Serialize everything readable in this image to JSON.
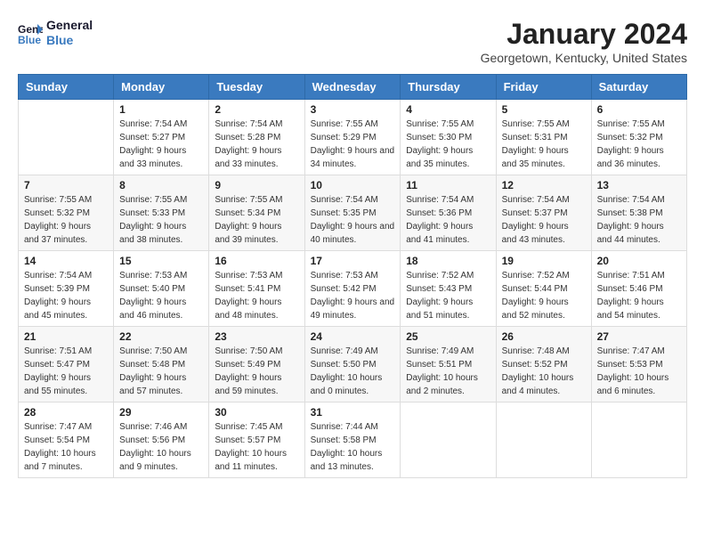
{
  "header": {
    "logo_line1": "General",
    "logo_line2": "Blue",
    "month_title": "January 2024",
    "location": "Georgetown, Kentucky, United States"
  },
  "weekdays": [
    "Sunday",
    "Monday",
    "Tuesday",
    "Wednesday",
    "Thursday",
    "Friday",
    "Saturday"
  ],
  "weeks": [
    [
      {
        "day": "",
        "sunrise": "",
        "sunset": "",
        "daylight": ""
      },
      {
        "day": "1",
        "sunrise": "Sunrise: 7:54 AM",
        "sunset": "Sunset: 5:27 PM",
        "daylight": "Daylight: 9 hours and 33 minutes."
      },
      {
        "day": "2",
        "sunrise": "Sunrise: 7:54 AM",
        "sunset": "Sunset: 5:28 PM",
        "daylight": "Daylight: 9 hours and 33 minutes."
      },
      {
        "day": "3",
        "sunrise": "Sunrise: 7:55 AM",
        "sunset": "Sunset: 5:29 PM",
        "daylight": "Daylight: 9 hours and 34 minutes."
      },
      {
        "day": "4",
        "sunrise": "Sunrise: 7:55 AM",
        "sunset": "Sunset: 5:30 PM",
        "daylight": "Daylight: 9 hours and 35 minutes."
      },
      {
        "day": "5",
        "sunrise": "Sunrise: 7:55 AM",
        "sunset": "Sunset: 5:31 PM",
        "daylight": "Daylight: 9 hours and 35 minutes."
      },
      {
        "day": "6",
        "sunrise": "Sunrise: 7:55 AM",
        "sunset": "Sunset: 5:32 PM",
        "daylight": "Daylight: 9 hours and 36 minutes."
      }
    ],
    [
      {
        "day": "7",
        "sunrise": "Sunrise: 7:55 AM",
        "sunset": "Sunset: 5:32 PM",
        "daylight": "Daylight: 9 hours and 37 minutes."
      },
      {
        "day": "8",
        "sunrise": "Sunrise: 7:55 AM",
        "sunset": "Sunset: 5:33 PM",
        "daylight": "Daylight: 9 hours and 38 minutes."
      },
      {
        "day": "9",
        "sunrise": "Sunrise: 7:55 AM",
        "sunset": "Sunset: 5:34 PM",
        "daylight": "Daylight: 9 hours and 39 minutes."
      },
      {
        "day": "10",
        "sunrise": "Sunrise: 7:54 AM",
        "sunset": "Sunset: 5:35 PM",
        "daylight": "Daylight: 9 hours and 40 minutes."
      },
      {
        "day": "11",
        "sunrise": "Sunrise: 7:54 AM",
        "sunset": "Sunset: 5:36 PM",
        "daylight": "Daylight: 9 hours and 41 minutes."
      },
      {
        "day": "12",
        "sunrise": "Sunrise: 7:54 AM",
        "sunset": "Sunset: 5:37 PM",
        "daylight": "Daylight: 9 hours and 43 minutes."
      },
      {
        "day": "13",
        "sunrise": "Sunrise: 7:54 AM",
        "sunset": "Sunset: 5:38 PM",
        "daylight": "Daylight: 9 hours and 44 minutes."
      }
    ],
    [
      {
        "day": "14",
        "sunrise": "Sunrise: 7:54 AM",
        "sunset": "Sunset: 5:39 PM",
        "daylight": "Daylight: 9 hours and 45 minutes."
      },
      {
        "day": "15",
        "sunrise": "Sunrise: 7:53 AM",
        "sunset": "Sunset: 5:40 PM",
        "daylight": "Daylight: 9 hours and 46 minutes."
      },
      {
        "day": "16",
        "sunrise": "Sunrise: 7:53 AM",
        "sunset": "Sunset: 5:41 PM",
        "daylight": "Daylight: 9 hours and 48 minutes."
      },
      {
        "day": "17",
        "sunrise": "Sunrise: 7:53 AM",
        "sunset": "Sunset: 5:42 PM",
        "daylight": "Daylight: 9 hours and 49 minutes."
      },
      {
        "day": "18",
        "sunrise": "Sunrise: 7:52 AM",
        "sunset": "Sunset: 5:43 PM",
        "daylight": "Daylight: 9 hours and 51 minutes."
      },
      {
        "day": "19",
        "sunrise": "Sunrise: 7:52 AM",
        "sunset": "Sunset: 5:44 PM",
        "daylight": "Daylight: 9 hours and 52 minutes."
      },
      {
        "day": "20",
        "sunrise": "Sunrise: 7:51 AM",
        "sunset": "Sunset: 5:46 PM",
        "daylight": "Daylight: 9 hours and 54 minutes."
      }
    ],
    [
      {
        "day": "21",
        "sunrise": "Sunrise: 7:51 AM",
        "sunset": "Sunset: 5:47 PM",
        "daylight": "Daylight: 9 hours and 55 minutes."
      },
      {
        "day": "22",
        "sunrise": "Sunrise: 7:50 AM",
        "sunset": "Sunset: 5:48 PM",
        "daylight": "Daylight: 9 hours and 57 minutes."
      },
      {
        "day": "23",
        "sunrise": "Sunrise: 7:50 AM",
        "sunset": "Sunset: 5:49 PM",
        "daylight": "Daylight: 9 hours and 59 minutes."
      },
      {
        "day": "24",
        "sunrise": "Sunrise: 7:49 AM",
        "sunset": "Sunset: 5:50 PM",
        "daylight": "Daylight: 10 hours and 0 minutes."
      },
      {
        "day": "25",
        "sunrise": "Sunrise: 7:49 AM",
        "sunset": "Sunset: 5:51 PM",
        "daylight": "Daylight: 10 hours and 2 minutes."
      },
      {
        "day": "26",
        "sunrise": "Sunrise: 7:48 AM",
        "sunset": "Sunset: 5:52 PM",
        "daylight": "Daylight: 10 hours and 4 minutes."
      },
      {
        "day": "27",
        "sunrise": "Sunrise: 7:47 AM",
        "sunset": "Sunset: 5:53 PM",
        "daylight": "Daylight: 10 hours and 6 minutes."
      }
    ],
    [
      {
        "day": "28",
        "sunrise": "Sunrise: 7:47 AM",
        "sunset": "Sunset: 5:54 PM",
        "daylight": "Daylight: 10 hours and 7 minutes."
      },
      {
        "day": "29",
        "sunrise": "Sunrise: 7:46 AM",
        "sunset": "Sunset: 5:56 PM",
        "daylight": "Daylight: 10 hours and 9 minutes."
      },
      {
        "day": "30",
        "sunrise": "Sunrise: 7:45 AM",
        "sunset": "Sunset: 5:57 PM",
        "daylight": "Daylight: 10 hours and 11 minutes."
      },
      {
        "day": "31",
        "sunrise": "Sunrise: 7:44 AM",
        "sunset": "Sunset: 5:58 PM",
        "daylight": "Daylight: 10 hours and 13 minutes."
      },
      {
        "day": "",
        "sunrise": "",
        "sunset": "",
        "daylight": ""
      },
      {
        "day": "",
        "sunrise": "",
        "sunset": "",
        "daylight": ""
      },
      {
        "day": "",
        "sunrise": "",
        "sunset": "",
        "daylight": ""
      }
    ]
  ]
}
